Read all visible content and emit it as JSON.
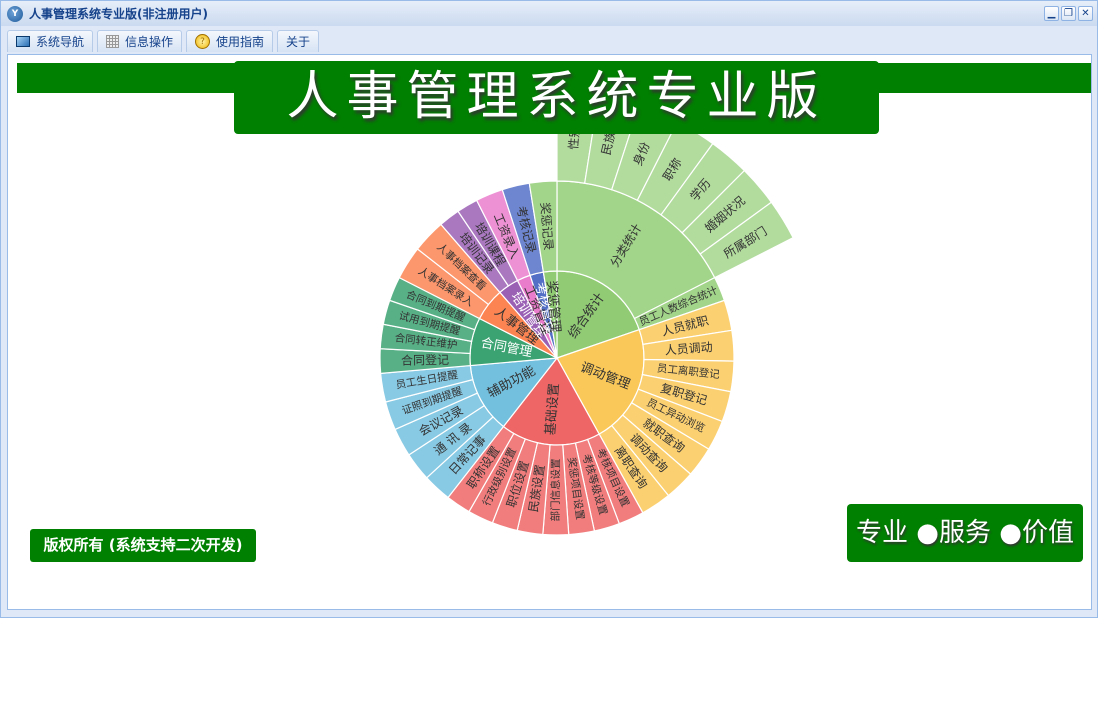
{
  "window": {
    "title": "人事管理系统专业版(非注册用户)",
    "logo": "Y",
    "controls": {
      "minimize": "▁",
      "restore": "❐",
      "close": "✕"
    }
  },
  "tabs": [
    {
      "label": "系统导航",
      "icon": "monitor-icon"
    },
    {
      "label": "信息操作",
      "icon": "grid-icon"
    },
    {
      "label": "使用指南",
      "icon": "help-icon"
    },
    {
      "label": "关于"
    }
  ],
  "banner": "人事管理系统专业版",
  "copyright": "版权所有 (系统支持二次开发)",
  "slogan": "专业 ●服务 ●价值",
  "chart_data": {
    "type": "sunburst",
    "children": [
      {
        "name": "综合统计",
        "color": "#91cc75",
        "labelColor": "#333",
        "children": [
          {
            "name": "分类统计",
            "children": [
              {
                "name": "性别",
                "value": 9
              },
              {
                "name": "民族",
                "value": 9
              },
              {
                "name": "身份",
                "value": 9
              },
              {
                "name": "职称",
                "value": 9
              },
              {
                "name": "学历",
                "value": 9
              },
              {
                "name": "婚姻状况",
                "value": 9
              },
              {
                "name": "所属部门",
                "value": 9
              }
            ]
          },
          {
            "name": "员工人数综合统计",
            "value": 8
          }
        ]
      },
      {
        "name": "调动管理",
        "color": "#fac858",
        "labelColor": "#333",
        "children": [
          {
            "name": "人员就职",
            "value": 10
          },
          {
            "name": "人员调动",
            "value": 10
          },
          {
            "name": "员工离职登记",
            "value": 10
          },
          {
            "name": "复职登记",
            "value": 10
          },
          {
            "name": "员工异动浏览",
            "value": 10
          },
          {
            "name": "就职查询",
            "value": 10
          },
          {
            "name": "调动查询",
            "value": 10
          },
          {
            "name": "离职查询",
            "value": 10
          }
        ]
      },
      {
        "name": "基础设置",
        "color": "#ee6666",
        "labelColor": "#333",
        "children": [
          {
            "name": "考核项目设置",
            "value": 8.4
          },
          {
            "name": "考核等级设置",
            "value": 8.4
          },
          {
            "name": "奖惩项目设置",
            "value": 8.4
          },
          {
            "name": "部门信息设置",
            "value": 8.4
          },
          {
            "name": "民族设置",
            "value": 8.4
          },
          {
            "name": "职位设置",
            "value": 8.4
          },
          {
            "name": "行政级别设置",
            "value": 8.4
          },
          {
            "name": "职称设置",
            "value": 8.2
          }
        ]
      },
      {
        "name": "辅助功能",
        "color": "#73c0de",
        "labelColor": "#333",
        "children": [
          {
            "name": "日常记事",
            "value": 9.4
          },
          {
            "name": "通 讯 录",
            "value": 9.4
          },
          {
            "name": "会议记录",
            "value": 9.4
          },
          {
            "name": "证照到期提醒",
            "value": 9.4
          },
          {
            "name": "员工生日提醒",
            "value": 9.4
          }
        ]
      },
      {
        "name": "合同管理",
        "color": "#3ba272",
        "labelColor": "#fff",
        "children": [
          {
            "name": "合同登记",
            "value": 8
          },
          {
            "name": "合同转正维护",
            "value": 8
          },
          {
            "name": "试用到期提醒",
            "value": 8
          },
          {
            "name": "合同到期提醒",
            "value": 8
          }
        ]
      },
      {
        "name": "人事管理",
        "color": "#fc8452",
        "labelColor": "#333",
        "children": [
          {
            "name": "人事档案录入",
            "value": 11
          },
          {
            "name": "人事档案查看",
            "value": 11
          }
        ]
      },
      {
        "name": "培训管理",
        "color": "#9a60b4",
        "labelColor": "#fff",
        "children": [
          {
            "name": "培训记录",
            "value": 7
          },
          {
            "name": "培训课程",
            "value": 7
          }
        ]
      },
      {
        "name": "工资管理",
        "color": "#ea7ccc",
        "labelColor": "#333",
        "children": [
          {
            "name": "工资录入",
            "value": 9
          }
        ]
      },
      {
        "name": "考核管理",
        "color": "#5470c6",
        "labelColor": "#fff",
        "children": [
          {
            "name": "考核记录",
            "value": 9
          }
        ]
      },
      {
        "name": "奖惩管理",
        "color": "#91cc75",
        "labelColor": "#333",
        "children": [
          {
            "name": "奖惩记录",
            "value": 9
          }
        ]
      }
    ]
  }
}
